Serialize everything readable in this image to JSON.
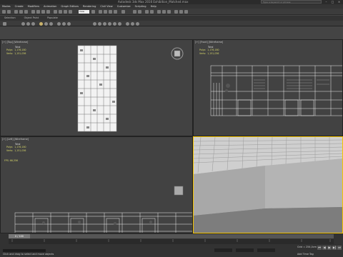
{
  "titlebar": {
    "title": "Autodesk 3ds Max 2016    Exhibition_Matched.max",
    "search_placeholder": "Type a keyword or phrase"
  },
  "menubar": {
    "items": [
      "Modes",
      "Create",
      "Modifiers",
      "Animation",
      "Graph Editors",
      "Rendering",
      "Civil View",
      "Customize",
      "Scripting",
      "Help"
    ]
  },
  "toolbar": {
    "selection_filter": "View"
  },
  "ribbon": {
    "tabs": [
      "Selection",
      "Object Paint",
      "Populate"
    ]
  },
  "viewports": {
    "top": {
      "label": "[+] [Top] [Wireframe]",
      "stats_header": "Total",
      "polys": "Polys:  1,176,180",
      "verts": "Verts:  1,151,036"
    },
    "front": {
      "label": "[+] [Front] [Wireframe]",
      "stats_header": "Total",
      "polys": "Polys:  1,176,180",
      "verts": "Verts:  1,151,036"
    },
    "left": {
      "label": "[+] [Left] [Wireframe]",
      "stats_header": "Total",
      "polys": "Polys:  1,176,180",
      "verts": "Verts:  1,151,036",
      "fps": "FPS:     66,356"
    },
    "perspective": {
      "label": "[+] [Perspective] [Realistic]"
    }
  },
  "statusbar": {
    "time_position": "0 / 100",
    "status": "Click and drag to select and move objects",
    "grid": "Grid = 254,0cm",
    "add_time_tag": "Add Time Tag",
    "play_buttons": [
      "⏮",
      "◀",
      "▶",
      "▶|",
      "⏭"
    ]
  },
  "colors": {
    "active_viewport": "#f5c400",
    "stats_text": "#d8d86a",
    "wireframe": "#e8e8e8"
  }
}
